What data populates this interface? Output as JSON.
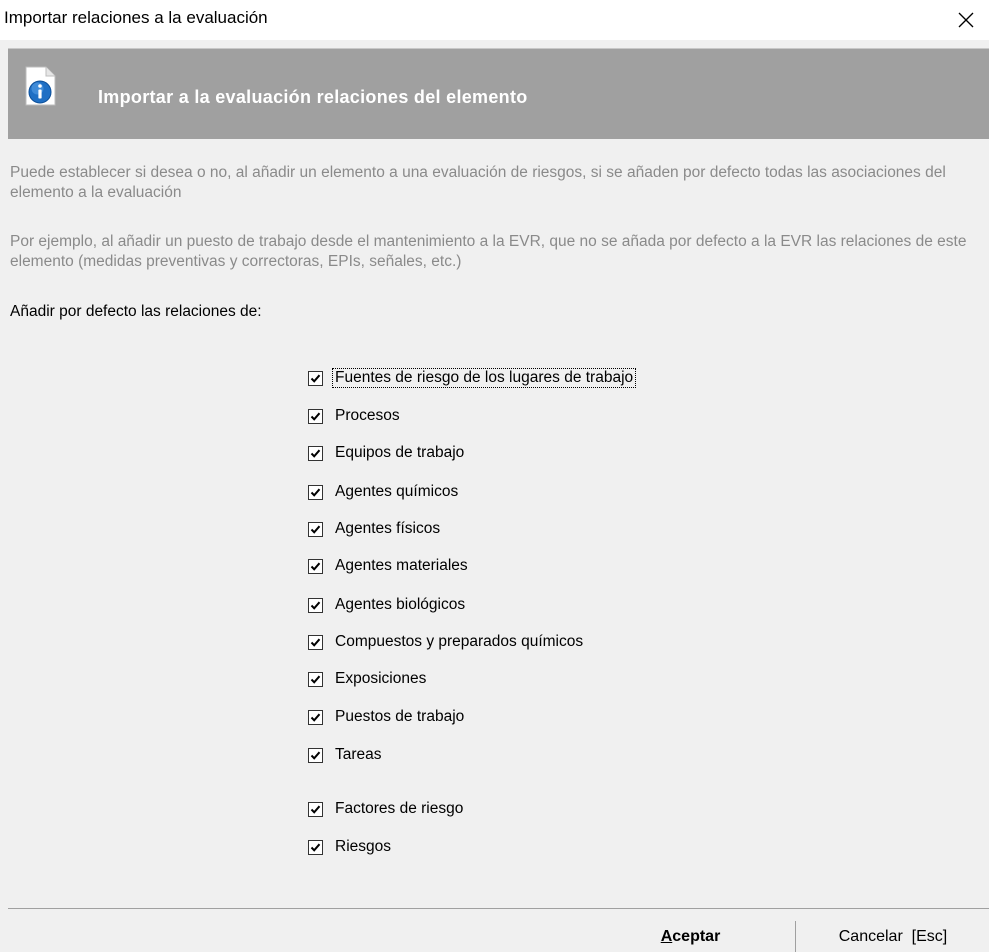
{
  "window": {
    "title": "Importar relaciones a la evaluación",
    "close_icon": "close-icon"
  },
  "banner": {
    "icon": "info-document-icon",
    "title": "Importar a la evaluación relaciones del elemento",
    "background": "#a0a0a0"
  },
  "description": {
    "paragraph1": "Puede establecer si desea o no, al añadir un elemento a una evaluación de riesgos, si se añaden por defecto todas las asociaciones del elemento a la evaluación",
    "paragraph2": "Por ejemplo, al añadir un puesto de trabajo desde el mantenimiento a la EVR, que no se añada por defecto a la EVR las relaciones de este elemento (medidas preventivas y correctoras, EPIs, señales, etc.)"
  },
  "section_label": "Añadir por defecto las relaciones de:",
  "checkboxes": [
    {
      "label": "Fuentes de riesgo de los lugares de trabajo",
      "checked": true
    },
    {
      "label": "Procesos",
      "checked": true
    },
    {
      "label": "Equipos de trabajo",
      "checked": true
    },
    {
      "label": "Agentes químicos",
      "checked": true
    },
    {
      "label": "Agentes físicos",
      "checked": true
    },
    {
      "label": "Agentes materiales",
      "checked": true
    },
    {
      "label": "Agentes biológicos",
      "checked": true
    },
    {
      "label": "Compuestos y preparados químicos",
      "checked": true
    },
    {
      "label": "Exposiciones",
      "checked": true
    },
    {
      "label": "Puestos de trabajo",
      "checked": true
    },
    {
      "label": "Tareas",
      "checked": true
    },
    {
      "label": "Factores de riesgo",
      "checked": true
    },
    {
      "label": "Riesgos",
      "checked": true
    }
  ],
  "buttons": {
    "ok_mnemonic": "A",
    "ok_rest": "ceptar",
    "cancel": "Cancelar  [Esc]"
  }
}
